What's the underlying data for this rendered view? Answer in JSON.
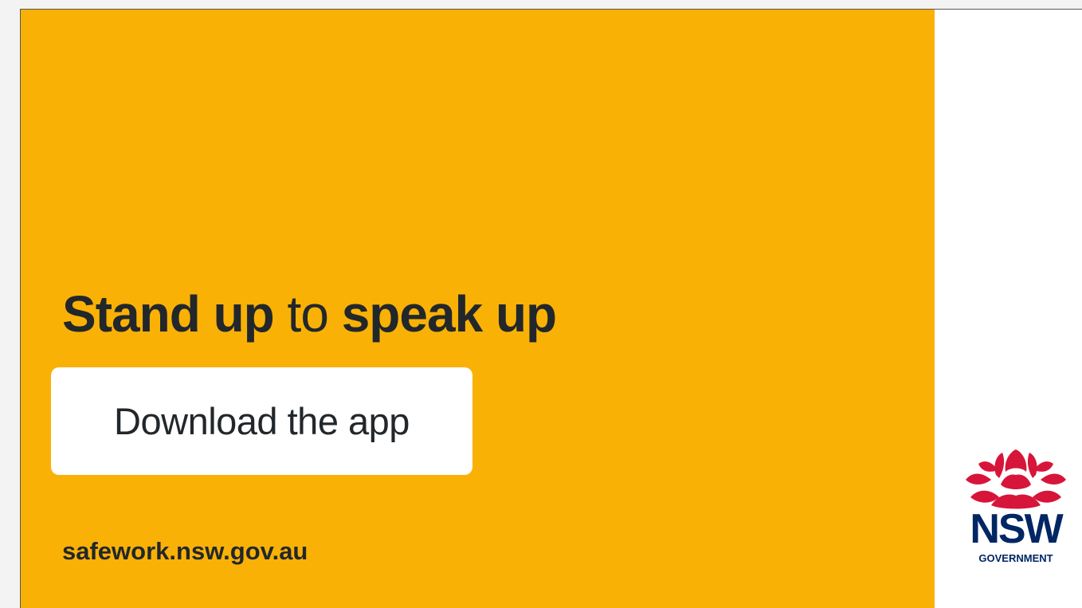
{
  "banner": {
    "headline": {
      "part1": "Stand up",
      "part2": " to ",
      "part3": "speak up"
    },
    "button_label": "Download the app",
    "url": "safework.nsw.gov.au"
  },
  "logo": {
    "icon": "waratah-icon",
    "title": "NSW",
    "subtitle": "GOVERNMENT"
  },
  "colors": {
    "panel_background": "#fab106",
    "text": "#22272b",
    "logo_red": "#d7153a",
    "logo_navy": "#002664"
  }
}
